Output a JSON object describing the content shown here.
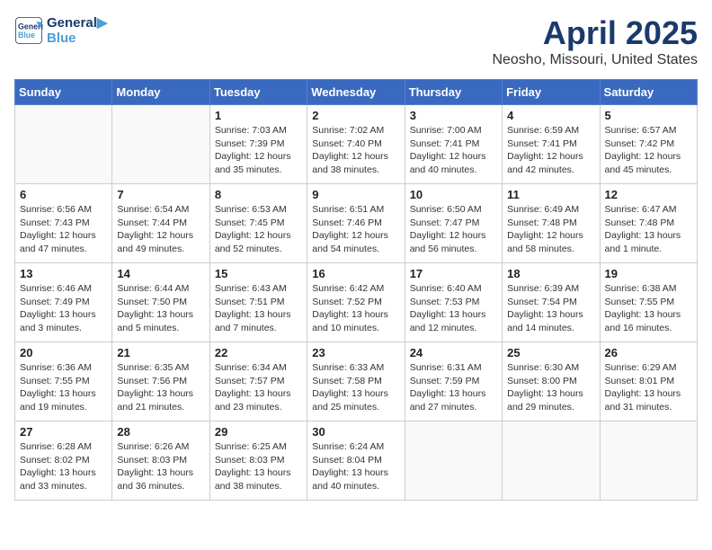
{
  "header": {
    "logo_line1": "General",
    "logo_line2": "Blue",
    "month": "April 2025",
    "location": "Neosho, Missouri, United States"
  },
  "weekdays": [
    "Sunday",
    "Monday",
    "Tuesday",
    "Wednesday",
    "Thursday",
    "Friday",
    "Saturday"
  ],
  "weeks": [
    [
      {
        "day": "",
        "info": ""
      },
      {
        "day": "",
        "info": ""
      },
      {
        "day": "1",
        "info": "Sunrise: 7:03 AM\nSunset: 7:39 PM\nDaylight: 12 hours\nand 35 minutes."
      },
      {
        "day": "2",
        "info": "Sunrise: 7:02 AM\nSunset: 7:40 PM\nDaylight: 12 hours\nand 38 minutes."
      },
      {
        "day": "3",
        "info": "Sunrise: 7:00 AM\nSunset: 7:41 PM\nDaylight: 12 hours\nand 40 minutes."
      },
      {
        "day": "4",
        "info": "Sunrise: 6:59 AM\nSunset: 7:41 PM\nDaylight: 12 hours\nand 42 minutes."
      },
      {
        "day": "5",
        "info": "Sunrise: 6:57 AM\nSunset: 7:42 PM\nDaylight: 12 hours\nand 45 minutes."
      }
    ],
    [
      {
        "day": "6",
        "info": "Sunrise: 6:56 AM\nSunset: 7:43 PM\nDaylight: 12 hours\nand 47 minutes."
      },
      {
        "day": "7",
        "info": "Sunrise: 6:54 AM\nSunset: 7:44 PM\nDaylight: 12 hours\nand 49 minutes."
      },
      {
        "day": "8",
        "info": "Sunrise: 6:53 AM\nSunset: 7:45 PM\nDaylight: 12 hours\nand 52 minutes."
      },
      {
        "day": "9",
        "info": "Sunrise: 6:51 AM\nSunset: 7:46 PM\nDaylight: 12 hours\nand 54 minutes."
      },
      {
        "day": "10",
        "info": "Sunrise: 6:50 AM\nSunset: 7:47 PM\nDaylight: 12 hours\nand 56 minutes."
      },
      {
        "day": "11",
        "info": "Sunrise: 6:49 AM\nSunset: 7:48 PM\nDaylight: 12 hours\nand 58 minutes."
      },
      {
        "day": "12",
        "info": "Sunrise: 6:47 AM\nSunset: 7:48 PM\nDaylight: 13 hours\nand 1 minute."
      }
    ],
    [
      {
        "day": "13",
        "info": "Sunrise: 6:46 AM\nSunset: 7:49 PM\nDaylight: 13 hours\nand 3 minutes."
      },
      {
        "day": "14",
        "info": "Sunrise: 6:44 AM\nSunset: 7:50 PM\nDaylight: 13 hours\nand 5 minutes."
      },
      {
        "day": "15",
        "info": "Sunrise: 6:43 AM\nSunset: 7:51 PM\nDaylight: 13 hours\nand 7 minutes."
      },
      {
        "day": "16",
        "info": "Sunrise: 6:42 AM\nSunset: 7:52 PM\nDaylight: 13 hours\nand 10 minutes."
      },
      {
        "day": "17",
        "info": "Sunrise: 6:40 AM\nSunset: 7:53 PM\nDaylight: 13 hours\nand 12 minutes."
      },
      {
        "day": "18",
        "info": "Sunrise: 6:39 AM\nSunset: 7:54 PM\nDaylight: 13 hours\nand 14 minutes."
      },
      {
        "day": "19",
        "info": "Sunrise: 6:38 AM\nSunset: 7:55 PM\nDaylight: 13 hours\nand 16 minutes."
      }
    ],
    [
      {
        "day": "20",
        "info": "Sunrise: 6:36 AM\nSunset: 7:55 PM\nDaylight: 13 hours\nand 19 minutes."
      },
      {
        "day": "21",
        "info": "Sunrise: 6:35 AM\nSunset: 7:56 PM\nDaylight: 13 hours\nand 21 minutes."
      },
      {
        "day": "22",
        "info": "Sunrise: 6:34 AM\nSunset: 7:57 PM\nDaylight: 13 hours\nand 23 minutes."
      },
      {
        "day": "23",
        "info": "Sunrise: 6:33 AM\nSunset: 7:58 PM\nDaylight: 13 hours\nand 25 minutes."
      },
      {
        "day": "24",
        "info": "Sunrise: 6:31 AM\nSunset: 7:59 PM\nDaylight: 13 hours\nand 27 minutes."
      },
      {
        "day": "25",
        "info": "Sunrise: 6:30 AM\nSunset: 8:00 PM\nDaylight: 13 hours\nand 29 minutes."
      },
      {
        "day": "26",
        "info": "Sunrise: 6:29 AM\nSunset: 8:01 PM\nDaylight: 13 hours\nand 31 minutes."
      }
    ],
    [
      {
        "day": "27",
        "info": "Sunrise: 6:28 AM\nSunset: 8:02 PM\nDaylight: 13 hours\nand 33 minutes."
      },
      {
        "day": "28",
        "info": "Sunrise: 6:26 AM\nSunset: 8:03 PM\nDaylight: 13 hours\nand 36 minutes."
      },
      {
        "day": "29",
        "info": "Sunrise: 6:25 AM\nSunset: 8:03 PM\nDaylight: 13 hours\nand 38 minutes."
      },
      {
        "day": "30",
        "info": "Sunrise: 6:24 AM\nSunset: 8:04 PM\nDaylight: 13 hours\nand 40 minutes."
      },
      {
        "day": "",
        "info": ""
      },
      {
        "day": "",
        "info": ""
      },
      {
        "day": "",
        "info": ""
      }
    ]
  ]
}
